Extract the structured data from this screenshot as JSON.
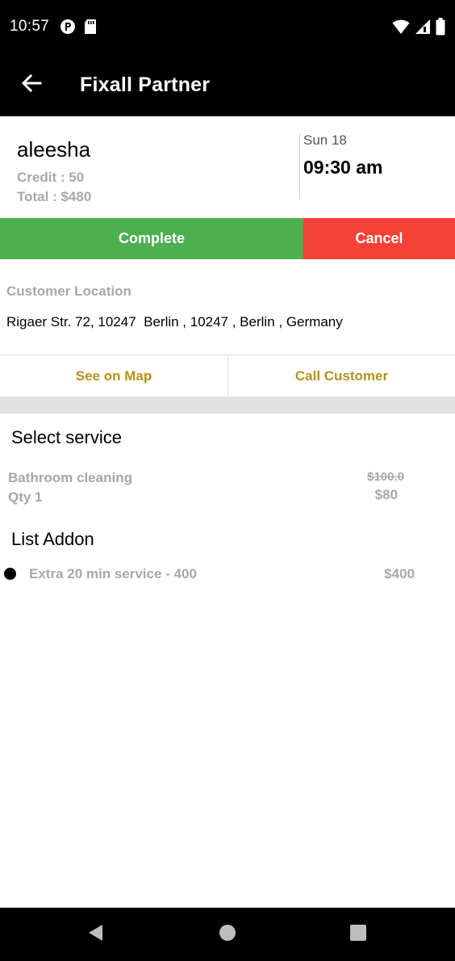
{
  "status_bar": {
    "time": "10:57",
    "icons": [
      "app-notification-icon",
      "sd-card-icon",
      "wifi-icon",
      "signal-icon",
      "battery-icon"
    ]
  },
  "app_bar": {
    "title": "Fixall Partner",
    "back_icon": "arrow-left-icon"
  },
  "booking": {
    "customer_name": "aleesha",
    "credit": "Credit : 50",
    "total": "Total : $480",
    "day": "Sun 18",
    "time": "09:30 am"
  },
  "actions": {
    "complete_label": "Complete",
    "cancel_label": "Cancel",
    "see_on_map_label": "See on Map",
    "call_customer_label": "Call Customer"
  },
  "location": {
    "label": "Customer Location",
    "address": "Rigaer Str. 72, 10247  Berlin , 10247 , Berlin , Germany"
  },
  "services": {
    "title": "Select service",
    "items": [
      {
        "name": "Bathroom cleaning",
        "qty": "Qty 1",
        "old_price": "$100.0",
        "price": "$80"
      }
    ]
  },
  "addons": {
    "title": "List Addon",
    "items": [
      {
        "name": "Extra 20 min service - 400",
        "price": "$400"
      }
    ]
  },
  "colors": {
    "complete": "#4caf50",
    "cancel": "#f44336",
    "accent_gold": "#b8901a",
    "muted_text": "#a8a8a8",
    "bar_background": "#000000"
  },
  "nav_bar": {
    "icons": [
      "back-triangle-icon",
      "home-circle-icon",
      "recents-square-icon"
    ]
  }
}
